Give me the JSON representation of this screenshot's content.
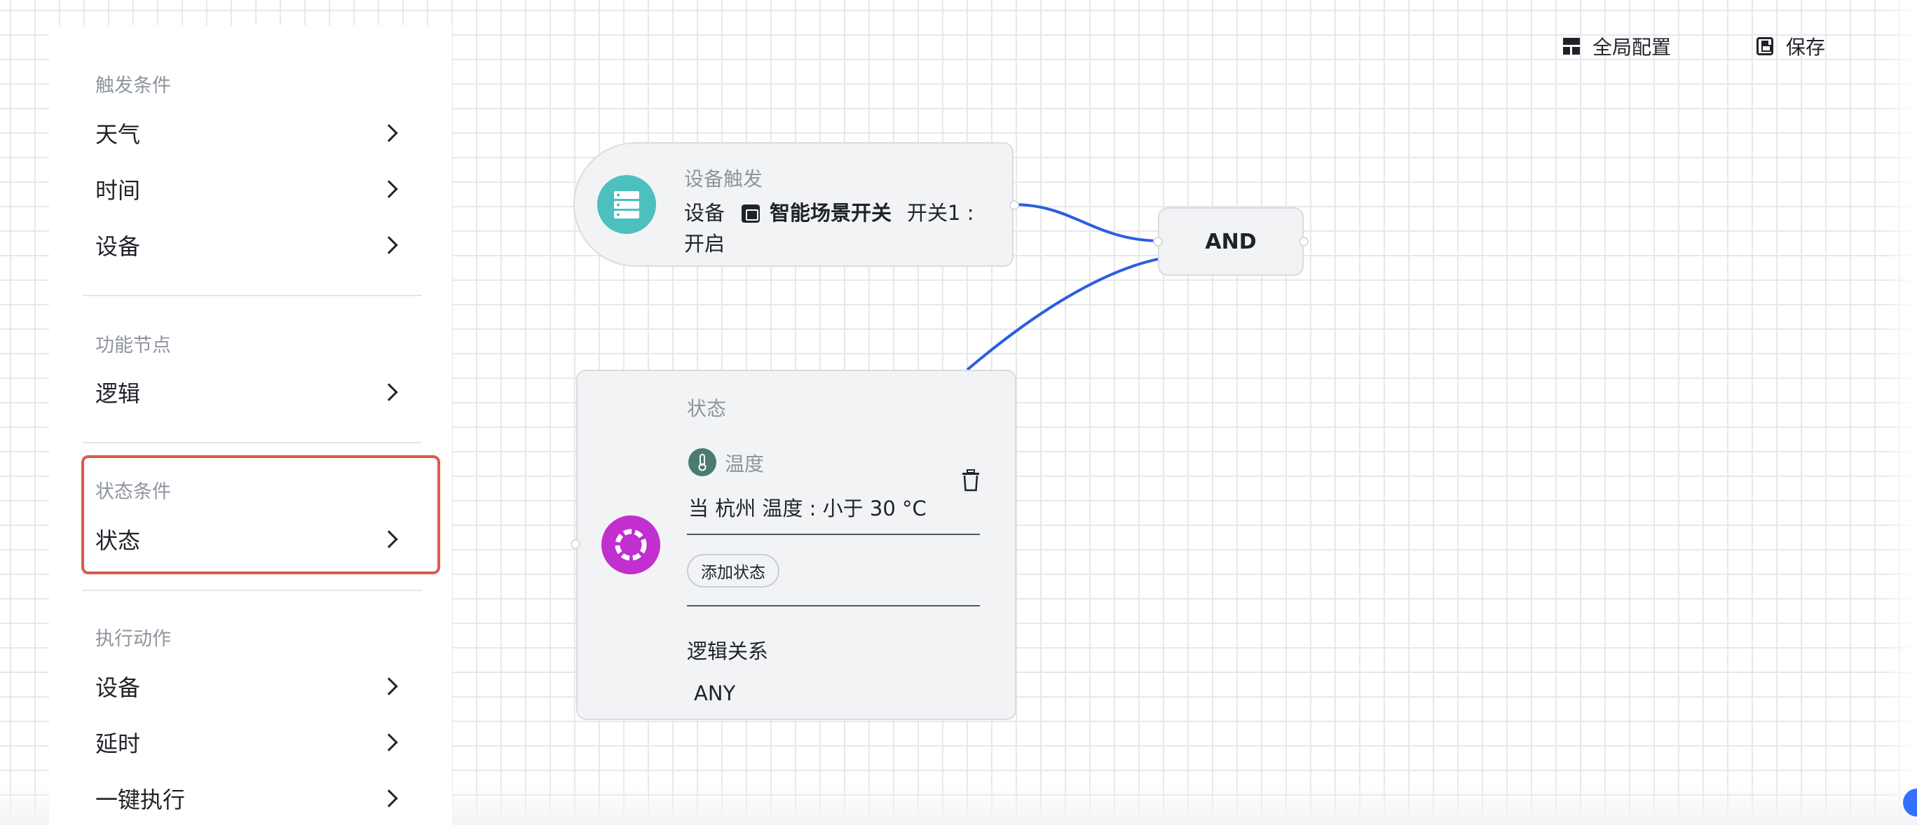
{
  "sidebar": {
    "sections": [
      {
        "title": "触发条件",
        "items": [
          "天气",
          "时间",
          "设备"
        ]
      },
      {
        "title": "功能节点",
        "items": [
          "逻辑"
        ]
      },
      {
        "title": "状态条件",
        "items": [
          "状态"
        ]
      },
      {
        "title": "执行动作",
        "items": [
          "设备",
          "延时",
          "一键执行"
        ]
      }
    ]
  },
  "toolbar": {
    "global_config_label": "全局配置",
    "save_label": "保存"
  },
  "nodes": {
    "trigger": {
      "title": "设备触发",
      "prefix": "设备",
      "device_name": "智能场景开关",
      "action_line1": "开关1 :",
      "action_line2": "开启",
      "icon": "server-icon",
      "icon_color": "#4dbfbf"
    },
    "logic": {
      "label": "AND"
    },
    "state": {
      "title": "状态",
      "condition_type": "温度",
      "condition_text": "当  杭州  温度 : 小于 30 °C",
      "add_state_label": "添加状态",
      "logic_relation_label": "逻辑关系",
      "logic_relation_value": "ANY",
      "icon": "lifebuoy-icon",
      "icon_color": "#c12fcf",
      "thermo_color": "#4a7c6f"
    }
  },
  "colors": {
    "connector": "#2b5ee0",
    "highlight": "#de5a4a"
  }
}
